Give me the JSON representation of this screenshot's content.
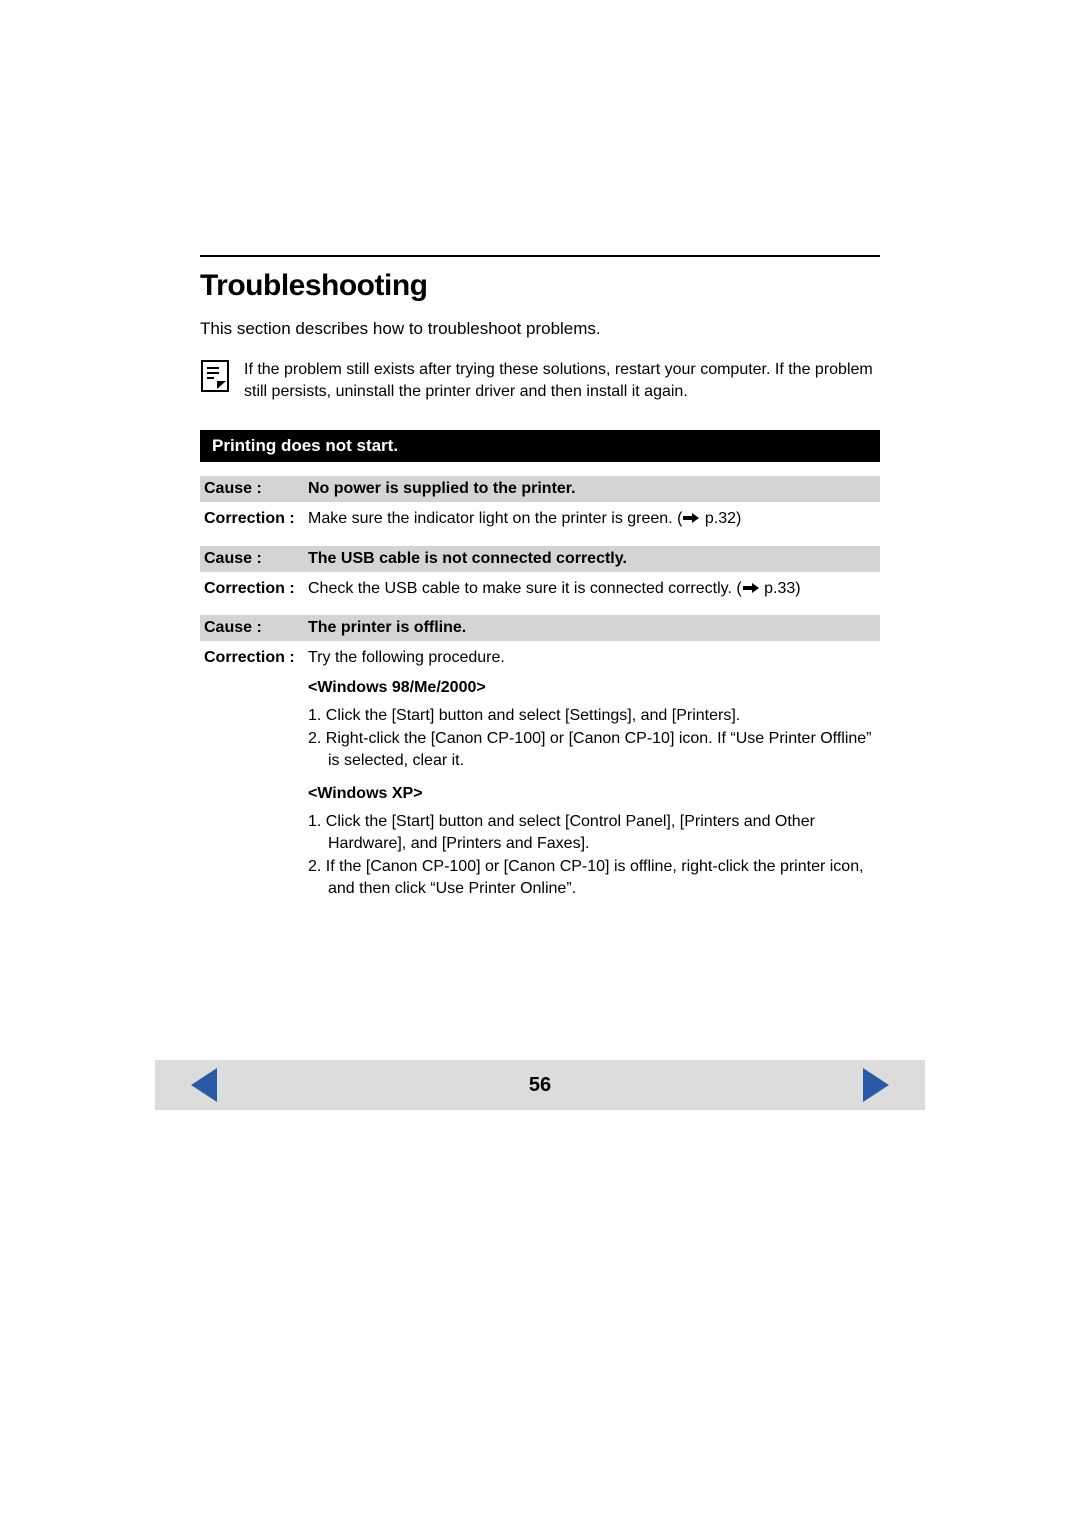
{
  "page": {
    "title": "Troubleshooting",
    "intro": "This section describes how to troubleshoot problems.",
    "note": "If the problem still exists after trying these solutions, restart your computer. If the problem still persists, uninstall the printer driver and then install it again.",
    "number": "56"
  },
  "section": {
    "header": "Printing does not start.",
    "labels": {
      "cause": "Cause :",
      "correction": "Correction :"
    },
    "items": [
      {
        "cause": "No power is supplied to the printer.",
        "correction_pre": "Make sure the indicator light on the printer is green. (",
        "correction_post": " p.32)"
      },
      {
        "cause": "The USB cable is not connected correctly.",
        "correction_pre": "Check the USB cable to make sure it is connected correctly. (",
        "correction_post": " p.33)"
      },
      {
        "cause": "The printer is offline.",
        "correction": "Try the following procedure."
      }
    ],
    "procedures": {
      "win98": {
        "heading": "<Windows 98/Me/2000>",
        "steps": [
          "1. Click the [Start] button and select [Settings], and [Printers].",
          "2. Right-click the [Canon CP-100] or [Canon CP-10] icon. If “Use Printer Offline” is selected, clear it."
        ]
      },
      "winxp": {
        "heading": "<Windows XP>",
        "steps": [
          "1. Click the [Start] button and select [Control Panel], [Printers and Other Hardware], and [Printers and Faxes].",
          "2. If the [Canon CP-100] or [Canon CP-10] is offline, right-click the printer icon, and then click “Use Printer Online”."
        ]
      }
    }
  },
  "nav": {
    "prev_color": "#2a5aa5",
    "next_color": "#2a5aa5"
  }
}
